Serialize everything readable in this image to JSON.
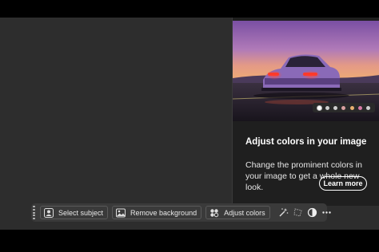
{
  "card": {
    "title": "Adjust colors in your image",
    "description": "Change the prominent colors in your image to get a whole new look.",
    "learn_more_label": "Learn more"
  },
  "taskbar": {
    "buttons": [
      {
        "label": "Select subject",
        "icon": "person-icon"
      },
      {
        "label": "Remove background",
        "icon": "image-icon"
      },
      {
        "label": "Adjust colors",
        "icon": "color-dots-icon"
      }
    ],
    "icons": [
      "magic-wand-icon",
      "lasso-icon",
      "contrast-icon",
      "more-icon"
    ]
  },
  "colors": {
    "accent_sky_top": "#7a5aa8",
    "accent_sunset": "#e88a5a",
    "card_bg": "#1f1f1f",
    "taskbar_bg": "#3a3a3a",
    "canvas_bg": "#2d2d2d"
  }
}
